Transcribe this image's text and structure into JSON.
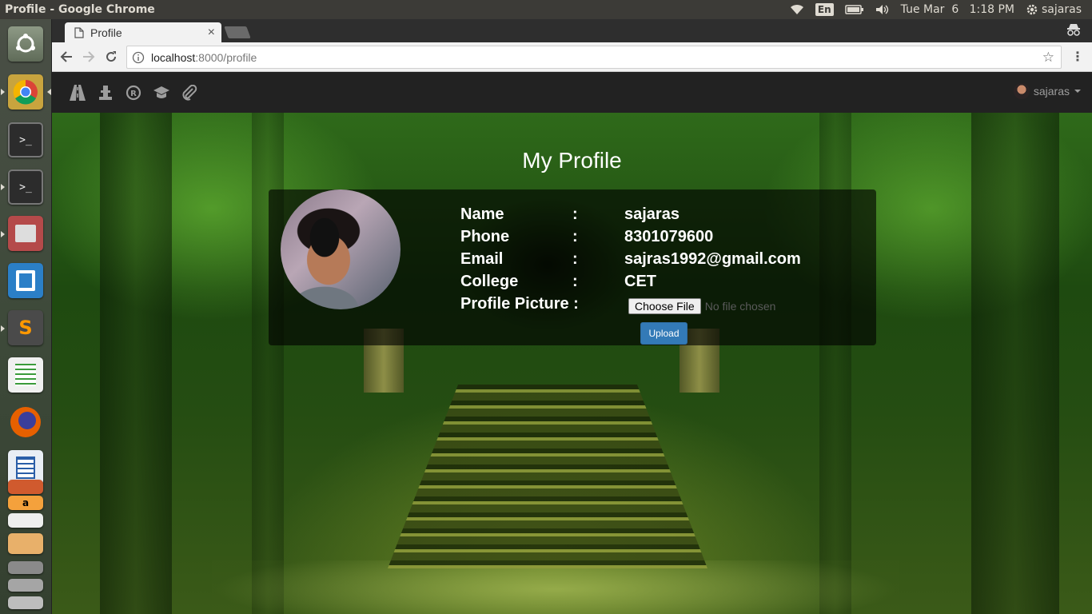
{
  "window": {
    "title": "Profile - Google Chrome"
  },
  "top_panel": {
    "keyboard_layout": "En",
    "datetime": "Tue Mar  6   1:18 PM",
    "user": "sajaras"
  },
  "launcher": {
    "items": [
      "ubuntu-dash",
      "chrome",
      "terminal",
      "terminal",
      "files-manager",
      "app",
      "sublime-text",
      "libreoffice-calc",
      "firefox",
      "libreoffice-writer",
      "libreoffice-impress",
      "amazon",
      "text-editor",
      "workspace-switcher",
      "trash"
    ]
  },
  "browser": {
    "tab": {
      "title": "Profile",
      "close": "×"
    },
    "url_host": "localhost",
    "url_rest": ":8000/profile"
  },
  "app_nav": {
    "icons": [
      "road-icon",
      "chess-pawn-icon",
      "registered-icon",
      "graduation-cap-icon",
      "paperclip-icon"
    ],
    "user": "sajaras"
  },
  "profile": {
    "heading": "My Profile",
    "fields": [
      {
        "label": "Name",
        "colon": ":",
        "value": "sajaras"
      },
      {
        "label": "Phone",
        "colon": ":",
        "value": "8301079600"
      },
      {
        "label": "Email",
        "colon": ":",
        "value": "sajras1992@gmail.com"
      },
      {
        "label": "College",
        "colon": ":",
        "value": "CET"
      }
    ],
    "picture_label": "Profile Picture :",
    "choose_file": "Choose File",
    "no_file": "No file chosen",
    "upload": "Upload"
  },
  "colors": {
    "primary_button": "#337ab7",
    "navbar": "#222222",
    "panel": "#3c3b37"
  }
}
